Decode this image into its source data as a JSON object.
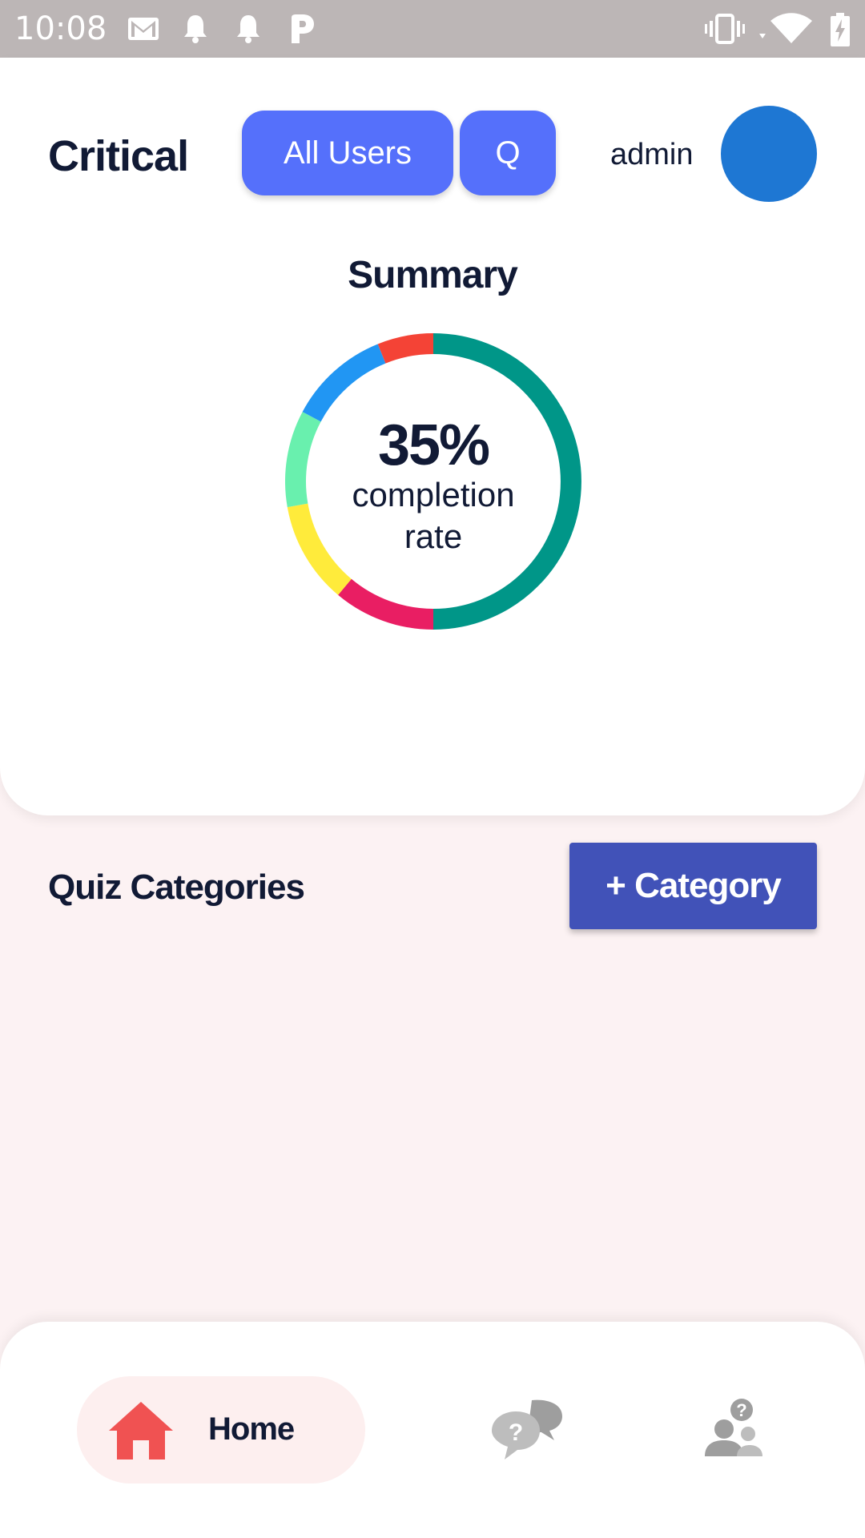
{
  "status_bar": {
    "time": "10:08",
    "left_icons": [
      "gmail-icon",
      "notification-bell-icon",
      "notification-bell-icon",
      "parking-icon"
    ],
    "right_icons": [
      "vibrate-icon",
      "wifi-icon",
      "battery-charging-icon"
    ]
  },
  "header": {
    "title": "Critical",
    "all_users_label": "All Users",
    "q_label": "Q",
    "username": "admin",
    "avatar_color": "#1e77d3"
  },
  "summary": {
    "title": "Summary",
    "percent": "35%",
    "label": "completion rate",
    "ring_colors": [
      "#009688",
      "#e91e63",
      "#ffeb3b",
      "#69f0ae",
      "#2196f3",
      "#f44336"
    ]
  },
  "categories": {
    "title": "Quiz Categories",
    "add_label": "+ Category"
  },
  "bottom_nav": {
    "items": [
      {
        "label": "Home",
        "icon": "home-icon",
        "active": true
      },
      {
        "icon": "quiz-chat-icon",
        "active": false
      },
      {
        "icon": "users-question-icon",
        "active": false
      }
    ]
  },
  "colors": {
    "primary": "#5570fb",
    "category_button": "#4152b8",
    "active_nav": "#f05252"
  }
}
